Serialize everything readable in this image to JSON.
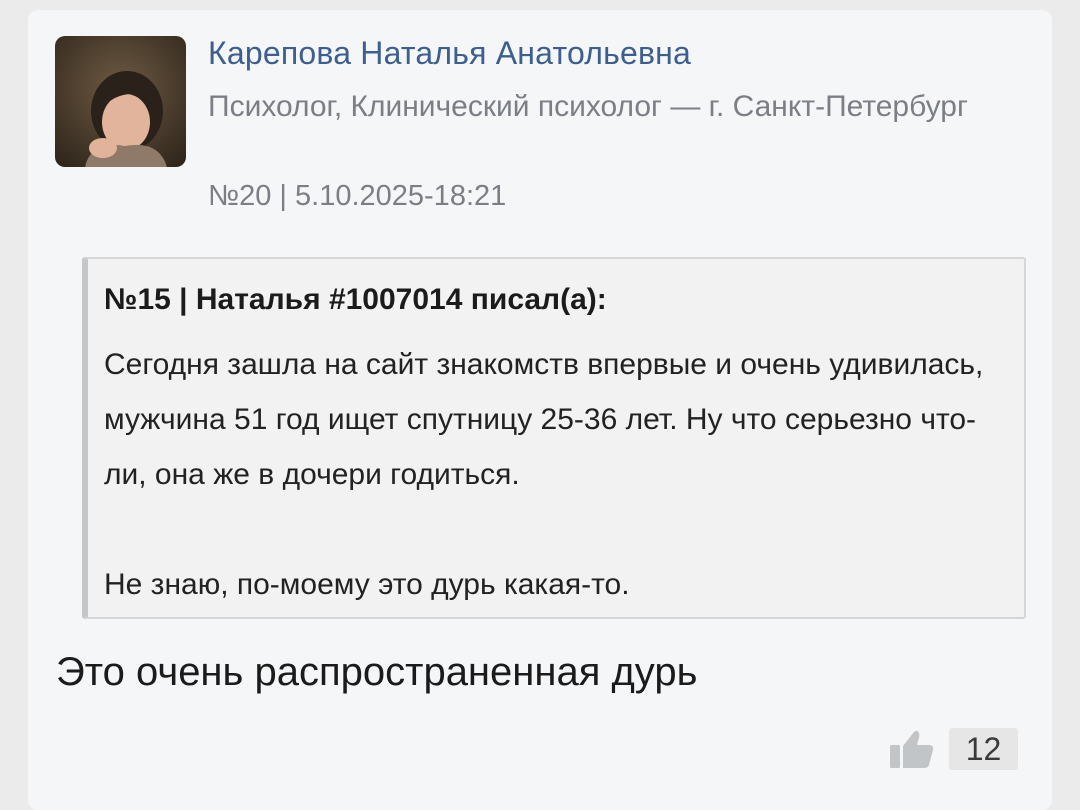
{
  "post": {
    "author": {
      "name": "Карепова Наталья Анатольевна",
      "title": "Психолог, Клинический психолог — г. Санкт-Петербург"
    },
    "meta": "№20 | 5.10.2025-18:21",
    "quote": {
      "header": "№15 | Наталья #1007014 писал(а):",
      "paragraphs": [
        "Сегодня зашла на сайт знакомств впервые и очень удивилась, мужчина 51 год ищет спутницу 25-36 лет. Ну что серьезно что-ли, она же в дочери годиться.",
        "Не знаю, по-моему это дурь какая-то."
      ]
    },
    "text": "Это очень распространенная дурь",
    "likes": {
      "icon": "thumbs-up-icon",
      "count": "12"
    }
  },
  "colors": {
    "author_link": "#3d5f8f",
    "muted_text": "#7b7f85",
    "card_background": "#f5f6f8",
    "quote_background": "#f2f2f2"
  }
}
